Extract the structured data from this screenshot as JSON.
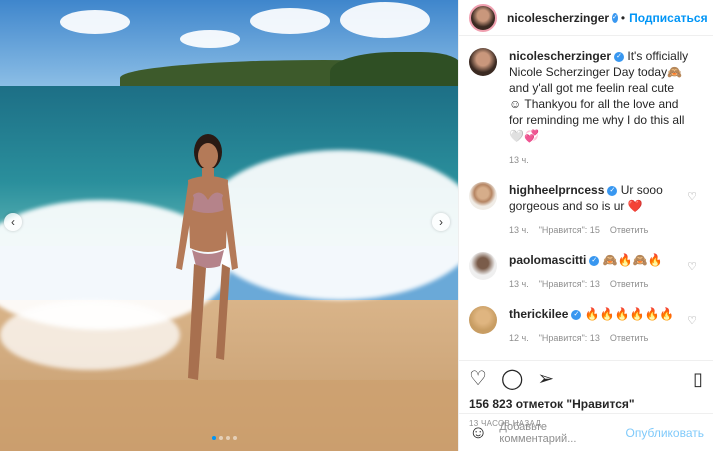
{
  "post": {
    "author": {
      "username": "nicolescherzinger",
      "follow_label": "Подписаться"
    },
    "caption": {
      "username": "nicolescherzinger",
      "text": "It's officially Nicole Scherzinger Day today🙈 and y'all got me feelin real cute ☺ Thankyou for all the love and for reminding me why I do this all 🤍💞",
      "time": "13 ч."
    },
    "comments": [
      {
        "username": "highheelprncess",
        "text": "Ur sooo gorgeous and so is ur ❤️",
        "time": "13 ч.",
        "likes": "\"Нравится\": 15",
        "reply": "Ответить"
      },
      {
        "username": "paolomascitti",
        "text": "🙈🔥🙈🔥",
        "time": "13 ч.",
        "likes": "\"Нравится\": 13",
        "reply": "Ответить"
      },
      {
        "username": "therickilee",
        "text": "🔥🔥🔥🔥🔥🔥",
        "time": "12 ч.",
        "likes": "\"Нравится\": 13",
        "reply": "Ответить"
      }
    ],
    "likes_text": "156 823 отметок \"Нравится\"",
    "posted_ago": "13 ЧАСОВ НАЗАД",
    "add_comment_placeholder": "Добавьте комментарий...",
    "publish_label": "Опубликовать",
    "carousel": {
      "current": 1,
      "total": 4
    }
  },
  "icons": {
    "like": "heart-icon",
    "comment": "comment-icon",
    "share": "share-icon",
    "save": "bookmark-icon",
    "emoji": "smile-icon"
  },
  "colors": {
    "link": "#0095f6",
    "verified": "#3897f0",
    "muted": "#8e8e8e"
  }
}
